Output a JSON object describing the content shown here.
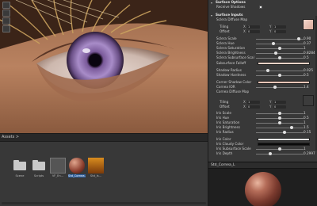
{
  "inspector": {
    "surface_options": {
      "title": "Surface Options",
      "receive_shadows": {
        "label": "Receive Shadows",
        "checked": true
      }
    },
    "surface_inputs": {
      "title": "Surface Inputs",
      "diffuse_map_label": "Sclera Diffuse Map",
      "tiling_label": "Tiling",
      "tiling_x_label": "X",
      "tiling_x": "1",
      "tiling_y_label": "Y",
      "tiling_y": "1",
      "offset_label": "Offset",
      "offset_x_label": "X",
      "offset_x": "0",
      "offset_y_label": "Y",
      "offset_y": "0",
      "sliders": [
        {
          "label": "Sclera Scale",
          "value": "0.90",
          "fraction": 0.9
        },
        {
          "label": "Sclera Hue",
          "value": "0.37",
          "fraction": 0.37
        },
        {
          "label": "Sclera Saturation",
          "value": "1",
          "fraction": 0.5
        },
        {
          "label": "Sclera Brightness",
          "value": "0.8284",
          "fraction": 0.41
        },
        {
          "label": "Sclera Subsurface Scal",
          "value": "0.5",
          "fraction": 0.5
        }
      ],
      "subsurface_falloff_label": "Subsurface Falloff",
      "subsurface_falloff_color": "#f3d4c8",
      "shadow_sliders": [
        {
          "label": "Shadow Radius",
          "value": "0.025",
          "fraction": 0.25
        },
        {
          "label": "Shadow Hardness",
          "value": "0.5",
          "fraction": 0.5
        }
      ],
      "corner_shadow_label": "Corner Shadow Color",
      "corner_shadow_color": "#f4c6b8",
      "cornea_ior_label": "Cornea IOR",
      "cornea_ior_value": "1.4",
      "cornea_ior_fraction": 0.4,
      "cornea_diffuse_label": "Cornea Diffuse Map",
      "cornea_tiling_label": "Tiling",
      "cornea_tiling_x_label": "X",
      "cornea_tiling_x": "1",
      "cornea_tiling_y_label": "Y",
      "cornea_tiling_y": "1",
      "cornea_offset_label": "Offset",
      "cornea_offset_x_label": "X",
      "cornea_offset_x": "0",
      "cornea_offset_y_label": "Y",
      "cornea_offset_y": "0",
      "iris_sliders": [
        {
          "label": "Iris Scale",
          "value": "1",
          "fraction": 0.5
        },
        {
          "label": "Iris Hue",
          "value": "0.5",
          "fraction": 0.5
        },
        {
          "label": "Iris Saturation",
          "value": "1",
          "fraction": 0.5
        },
        {
          "label": "Iris Brightness",
          "value": "1.5",
          "fraction": 0.75
        },
        {
          "label": "Iris Radius",
          "value": "0.15",
          "fraction": 0.6
        }
      ],
      "iris_color_label": "Iris Color",
      "iris_color": "#eef4f2",
      "iris_cloudy_label": "Iris Cloudy Color",
      "iris_cloudy_color": "#0a0a0a",
      "iris_subsurface_label": "Iris Subsurface Scale",
      "iris_subsurface_value": "1",
      "iris_subsurface_fraction": 0.5,
      "iris_depth_label": "Iris Depth",
      "iris_depth_value": "0.2997",
      "iris_depth_fraction": 0.3
    }
  },
  "project": {
    "breadcrumb": "Assets >",
    "assets": [
      {
        "label": "Scene",
        "kind": "folder"
      },
      {
        "label": "Scripts",
        "kind": "folder"
      },
      {
        "label": "VF_En...",
        "kind": "prefab"
      },
      {
        "label": "Std_Cornea...",
        "kind": "material"
      },
      {
        "label": "Std_Is...",
        "kind": "texture"
      }
    ]
  },
  "preview": {
    "title": "Std_Cornea_L"
  }
}
